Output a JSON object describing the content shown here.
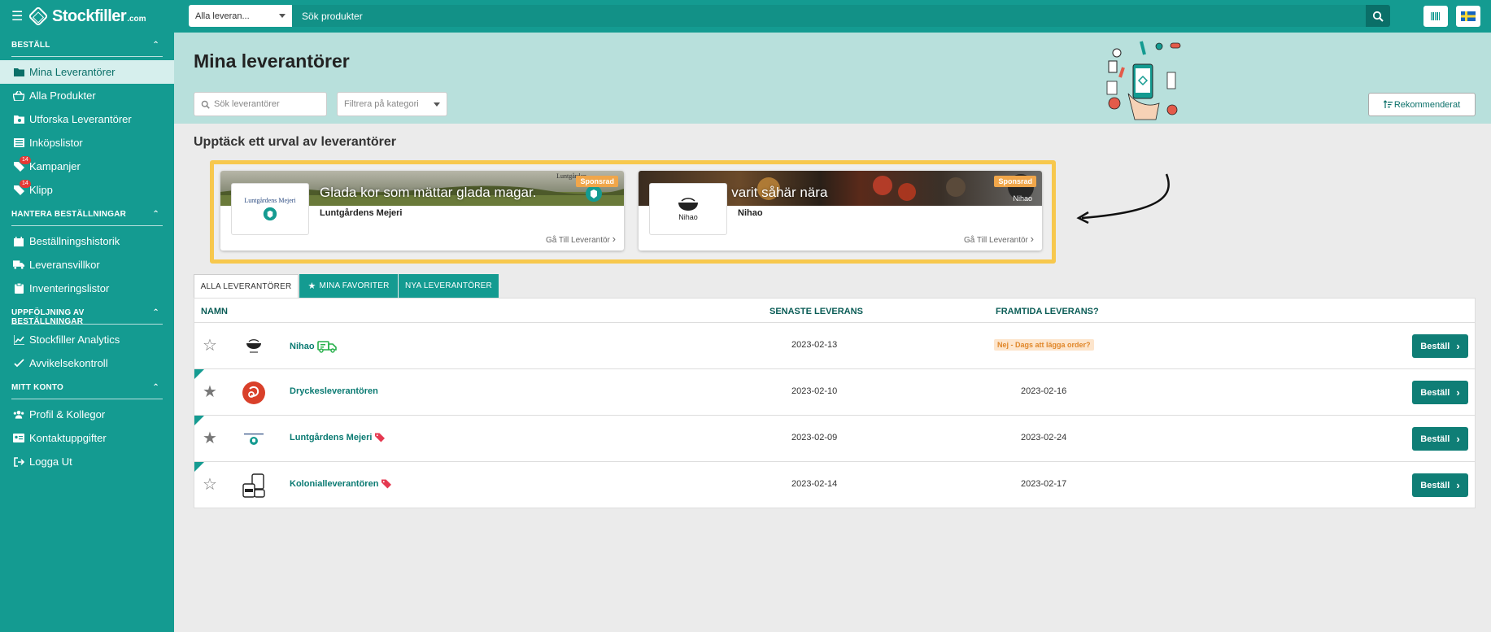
{
  "topbar": {
    "brand": "Stockfiller",
    "brand_suffix": ".com",
    "category_select": "Alla leveran...",
    "search_placeholder": "Sök produkter"
  },
  "sidebar": {
    "sections": [
      {
        "title": "BESTÄLL",
        "items": [
          {
            "label": "Mina Leverantörer",
            "icon": "folder-icon",
            "active": true
          },
          {
            "label": "Alla Produkter",
            "icon": "basket-icon"
          },
          {
            "label": "Utforska Leverantörer",
            "icon": "folder-search-icon"
          },
          {
            "label": "Inköpslistor",
            "icon": "list-icon"
          },
          {
            "label": "Kampanjer",
            "icon": "tag-icon",
            "badge": "14"
          },
          {
            "label": "Klipp",
            "icon": "tag-icon",
            "badge": "14"
          }
        ]
      },
      {
        "title": "HANTERA BESTÄLLNINGAR",
        "items": [
          {
            "label": "Beställningshistorik",
            "icon": "calendar-icon"
          },
          {
            "label": "Leveransvillkor",
            "icon": "truck-icon"
          },
          {
            "label": "Inventeringslistor",
            "icon": "clipboard-icon"
          }
        ]
      },
      {
        "title": "UPPFÖLJNING AV BESTÄLLNINGAR",
        "items": [
          {
            "label": "Stockfiller Analytics",
            "icon": "chart-icon"
          },
          {
            "label": "Avvikelsekontroll",
            "icon": "check-icon"
          }
        ]
      },
      {
        "title": "MITT KONTO",
        "items": [
          {
            "label": "Profil & Kollegor",
            "icon": "users-icon"
          },
          {
            "label": "Kontaktuppgifter",
            "icon": "contact-icon"
          },
          {
            "label": "Logga Ut",
            "icon": "logout-icon"
          }
        ]
      }
    ]
  },
  "main": {
    "title": "Mina leverantörer",
    "search_suppliers_placeholder": "Sök leverantörer",
    "category_filter_placeholder": "Filtrera på kategori",
    "sort_button": "Rekommenderat",
    "discover_title": "Upptäck ett urval av leverantörer"
  },
  "sponsored": [
    {
      "name": "Luntgårdens Mejeri",
      "slogan": "Glada kor som mättar glada magar.",
      "badge": "Sponsrad",
      "link": "Gå Till Leverantör",
      "logo_text": "Luntgårdens Mejeri",
      "banner_brand": "Luntgården"
    },
    {
      "name": "Nihao",
      "slogan": "aldrig varit såhär nära",
      "badge": "Sponsrad",
      "link": "Gå Till Leverantör",
      "logo_text": "Nihao",
      "banner_brand": "Nihao"
    }
  ],
  "tabs": [
    "ALLA LEVERANTÖRER",
    "MINA FAVORITER",
    "NYA LEVERANTÖRER"
  ],
  "table": {
    "headers": {
      "name": "NAMN",
      "last_delivery": "SENASTE LEVERANS",
      "future_delivery": "FRAMTIDA LEVERANS?"
    },
    "order_label": "Beställ",
    "rows": [
      {
        "name": "Nihao",
        "last": "2023-02-13",
        "future": "Nej - Dags att lägga order?",
        "future_warning": true,
        "favorite": false,
        "new": false,
        "icon": "truck-icon"
      },
      {
        "name": "Dryckesleverantören",
        "last": "2023-02-10",
        "future": "2023-02-16",
        "favorite": true,
        "new": true
      },
      {
        "name": "Luntgårdens Mejeri",
        "last": "2023-02-09",
        "future": "2023-02-24",
        "favorite": true,
        "new": true,
        "icon": "tag-icon"
      },
      {
        "name": "Kolonialleverantören",
        "last": "2023-02-14",
        "future": "2023-02-17",
        "favorite": false,
        "new": true,
        "icon": "tag-icon"
      }
    ]
  },
  "colors": {
    "primary": "#149b91",
    "header_bg": "#b8e0dc",
    "highlight": "#f7c84d",
    "order_button": "#0f7e76"
  }
}
